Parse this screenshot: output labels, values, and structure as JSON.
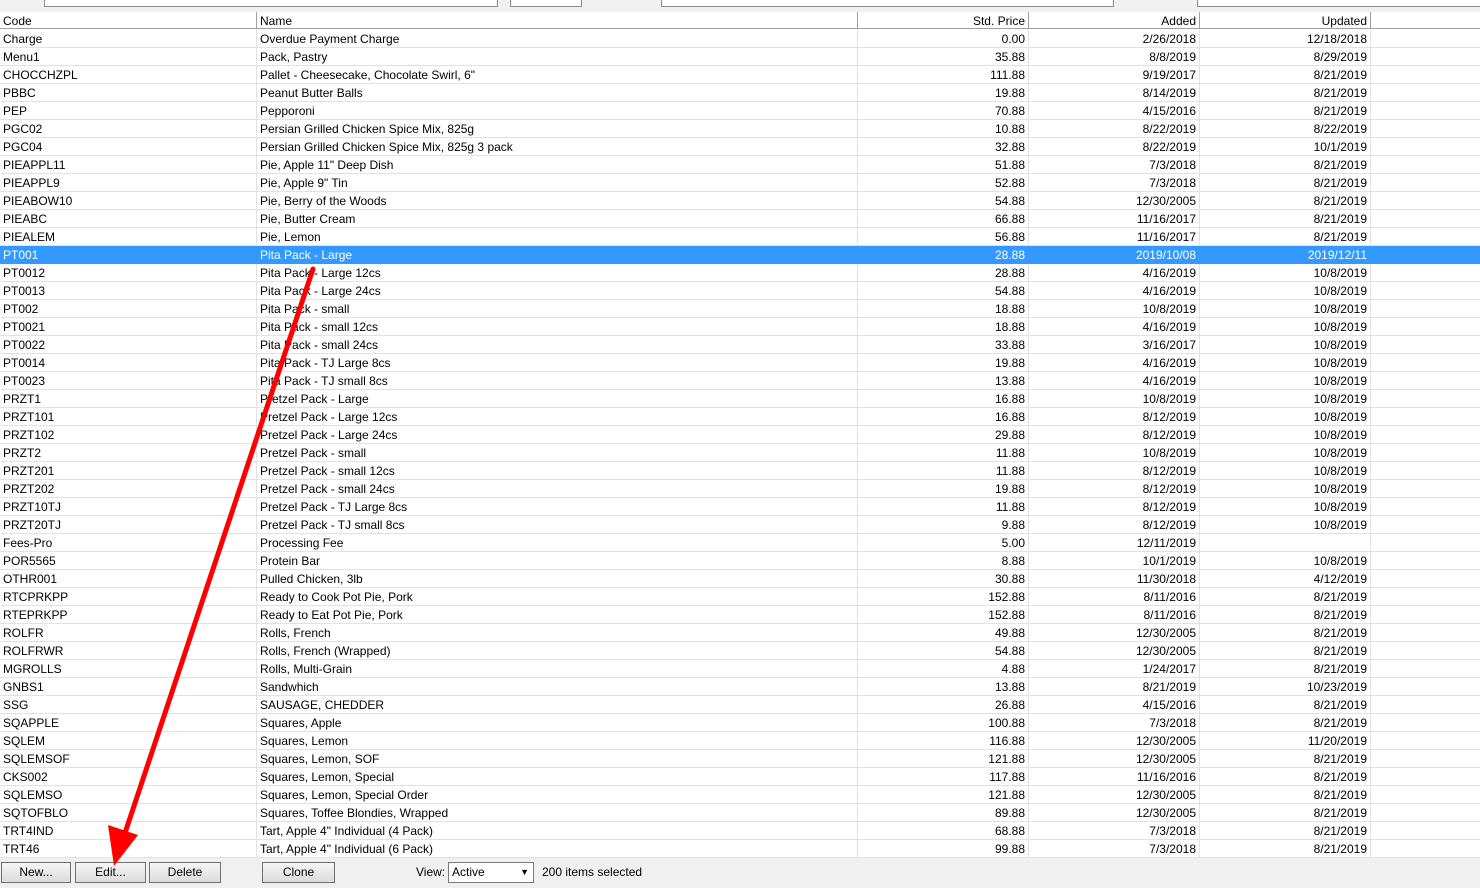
{
  "columns": [
    "Code",
    "Name",
    "Std. Price",
    "Added",
    "Updated"
  ],
  "rows": [
    {
      "code": "Charge",
      "name": "Overdue Payment Charge",
      "price": "0.00",
      "added": "2/26/2018",
      "updated": "12/18/2018"
    },
    {
      "code": "Menu1",
      "name": "Pack, Pastry",
      "price": "35.88",
      "added": "8/8/2019",
      "updated": "8/29/2019"
    },
    {
      "code": "CHOCCHZPL",
      "name": "Pallet - Cheesecake, Chocolate Swirl, 6\"",
      "price": "111.88",
      "added": "9/19/2017",
      "updated": "8/21/2019"
    },
    {
      "code": "PBBC",
      "name": "Peanut Butter Balls",
      "price": "19.88",
      "added": "8/14/2019",
      "updated": "8/21/2019"
    },
    {
      "code": "PEP",
      "name": "Pepporoni",
      "price": "70.88",
      "added": "4/15/2016",
      "updated": "8/21/2019"
    },
    {
      "code": "PGC02",
      "name": "Persian Grilled Chicken Spice Mix, 825g",
      "price": "10.88",
      "added": "8/22/2019",
      "updated": "8/22/2019"
    },
    {
      "code": "PGC04",
      "name": "Persian Grilled Chicken Spice Mix, 825g 3 pack",
      "price": "32.88",
      "added": "8/22/2019",
      "updated": "10/1/2019"
    },
    {
      "code": "PIEAPPL11",
      "name": "Pie, Apple 11\" Deep Dish",
      "price": "51.88",
      "added": "7/3/2018",
      "updated": "8/21/2019"
    },
    {
      "code": "PIEAPPL9",
      "name": "Pie, Apple 9\" Tin",
      "price": "52.88",
      "added": "7/3/2018",
      "updated": "8/21/2019"
    },
    {
      "code": "PIEABOW10",
      "name": "Pie, Berry of the Woods",
      "price": "54.88",
      "added": "12/30/2005",
      "updated": "8/21/2019"
    },
    {
      "code": "PIEABC",
      "name": "Pie, Butter Cream",
      "price": "66.88",
      "added": "11/16/2017",
      "updated": "8/21/2019"
    },
    {
      "code": "PIEALEM",
      "name": "Pie, Lemon",
      "price": "56.88",
      "added": "11/16/2017",
      "updated": "8/21/2019"
    },
    {
      "code": "PT001",
      "name": "Pita Pack - Large",
      "price": "28.88",
      "added": "2019/10/08",
      "updated": "2019/12/11"
    },
    {
      "code": "PT0012",
      "name": "Pita Pack - Large 12cs",
      "price": "28.88",
      "added": "4/16/2019",
      "updated": "10/8/2019"
    },
    {
      "code": "PT0013",
      "name": "Pita Pack - Large 24cs",
      "price": "54.88",
      "added": "4/16/2019",
      "updated": "10/8/2019"
    },
    {
      "code": "PT002",
      "name": "Pita Pack - small",
      "price": "18.88",
      "added": "10/8/2019",
      "updated": "10/8/2019"
    },
    {
      "code": "PT0021",
      "name": "Pita Pack - small 12cs",
      "price": "18.88",
      "added": "4/16/2019",
      "updated": "10/8/2019"
    },
    {
      "code": "PT0022",
      "name": "Pita Pack - small 24cs",
      "price": "33.88",
      "added": "3/16/2017",
      "updated": "10/8/2019"
    },
    {
      "code": "PT0014",
      "name": "Pita Pack - TJ Large 8cs",
      "price": "19.88",
      "added": "4/16/2019",
      "updated": "10/8/2019"
    },
    {
      "code": "PT0023",
      "name": "Pita Pack - TJ small 8cs",
      "price": "13.88",
      "added": "4/16/2019",
      "updated": "10/8/2019"
    },
    {
      "code": "PRZT1",
      "name": "Pretzel Pack - Large",
      "price": "16.88",
      "added": "10/8/2019",
      "updated": "10/8/2019"
    },
    {
      "code": "PRZT101",
      "name": "Pretzel Pack - Large 12cs",
      "price": "16.88",
      "added": "8/12/2019",
      "updated": "10/8/2019"
    },
    {
      "code": "PRZT102",
      "name": "Pretzel Pack - Large 24cs",
      "price": "29.88",
      "added": "8/12/2019",
      "updated": "10/8/2019"
    },
    {
      "code": "PRZT2",
      "name": "Pretzel Pack - small",
      "price": "11.88",
      "added": "10/8/2019",
      "updated": "10/8/2019"
    },
    {
      "code": "PRZT201",
      "name": "Pretzel Pack - small 12cs",
      "price": "11.88",
      "added": "8/12/2019",
      "updated": "10/8/2019"
    },
    {
      "code": "PRZT202",
      "name": "Pretzel Pack - small 24cs",
      "price": "19.88",
      "added": "8/12/2019",
      "updated": "10/8/2019"
    },
    {
      "code": "PRZT10TJ",
      "name": "Pretzel Pack - TJ Large 8cs",
      "price": "11.88",
      "added": "8/12/2019",
      "updated": "10/8/2019"
    },
    {
      "code": "PRZT20TJ",
      "name": "Pretzel Pack - TJ small 8cs",
      "price": "9.88",
      "added": "8/12/2019",
      "updated": "10/8/2019"
    },
    {
      "code": "Fees-Pro",
      "name": "Processing Fee",
      "price": "5.00",
      "added": "12/11/2019",
      "updated": ""
    },
    {
      "code": "POR5565",
      "name": "Protein Bar",
      "price": "8.88",
      "added": "10/1/2019",
      "updated": "10/8/2019"
    },
    {
      "code": "OTHR001",
      "name": "Pulled Chicken, 3lb",
      "price": "30.88",
      "added": "11/30/2018",
      "updated": "4/12/2019"
    },
    {
      "code": "RTCPRKPP",
      "name": "Ready to Cook Pot Pie, Pork",
      "price": "152.88",
      "added": "8/11/2016",
      "updated": "8/21/2019"
    },
    {
      "code": "RTEPRKPP",
      "name": "Ready to Eat Pot Pie, Pork",
      "price": "152.88",
      "added": "8/11/2016",
      "updated": "8/21/2019"
    },
    {
      "code": "ROLFR",
      "name": "Rolls, French",
      "price": "49.88",
      "added": "12/30/2005",
      "updated": "8/21/2019"
    },
    {
      "code": "ROLFRWR",
      "name": "Rolls, French (Wrapped)",
      "price": "54.88",
      "added": "12/30/2005",
      "updated": "8/21/2019"
    },
    {
      "code": "MGROLLS",
      "name": "Rolls, Multi-Grain",
      "price": "4.88",
      "added": "1/24/2017",
      "updated": "8/21/2019"
    },
    {
      "code": "GNBS1",
      "name": "Sandwhich",
      "price": "13.88",
      "added": "8/21/2019",
      "updated": "10/23/2019"
    },
    {
      "code": "SSG",
      "name": "SAUSAGE, CHEDDER",
      "price": "26.88",
      "added": "4/15/2016",
      "updated": "8/21/2019"
    },
    {
      "code": "SQAPPLE",
      "name": "Squares, Apple",
      "price": "100.88",
      "added": "7/3/2018",
      "updated": "8/21/2019"
    },
    {
      "code": "SQLEM",
      "name": "Squares, Lemon",
      "price": "116.88",
      "added": "12/30/2005",
      "updated": "11/20/2019"
    },
    {
      "code": "SQLEMSOF",
      "name": "Squares, Lemon, SOF",
      "price": "121.88",
      "added": "12/30/2005",
      "updated": "8/21/2019"
    },
    {
      "code": "CKS002",
      "name": "Squares, Lemon, Special",
      "price": "117.88",
      "added": "11/16/2016",
      "updated": "8/21/2019"
    },
    {
      "code": "SQLEMSO",
      "name": "Squares, Lemon, Special Order",
      "price": "121.88",
      "added": "12/30/2005",
      "updated": "8/21/2019"
    },
    {
      "code": "SQTOFBLO",
      "name": "Squares, Toffee Blondies, Wrapped",
      "price": "89.88",
      "added": "12/30/2005",
      "updated": "8/21/2019"
    },
    {
      "code": "TRT4IND",
      "name": "Tart, Apple 4\" Individual (4 Pack)",
      "price": "68.88",
      "added": "7/3/2018",
      "updated": "8/21/2019"
    },
    {
      "code": "TRT46",
      "name": "Tart, Apple 4\" Individual (6 Pack)",
      "price": "99.88",
      "added": "7/3/2018",
      "updated": "8/21/2019"
    }
  ],
  "selected_index": 12,
  "buttons": {
    "new": "New...",
    "edit": "Edit...",
    "delete": "Delete",
    "clone": "Clone"
  },
  "view": {
    "label": "View:",
    "value": "Active"
  },
  "status": {
    "selected_count": "200 items selected"
  },
  "colors": {
    "selection": "#3399ff",
    "annotation_arrow": "#ff0000"
  }
}
